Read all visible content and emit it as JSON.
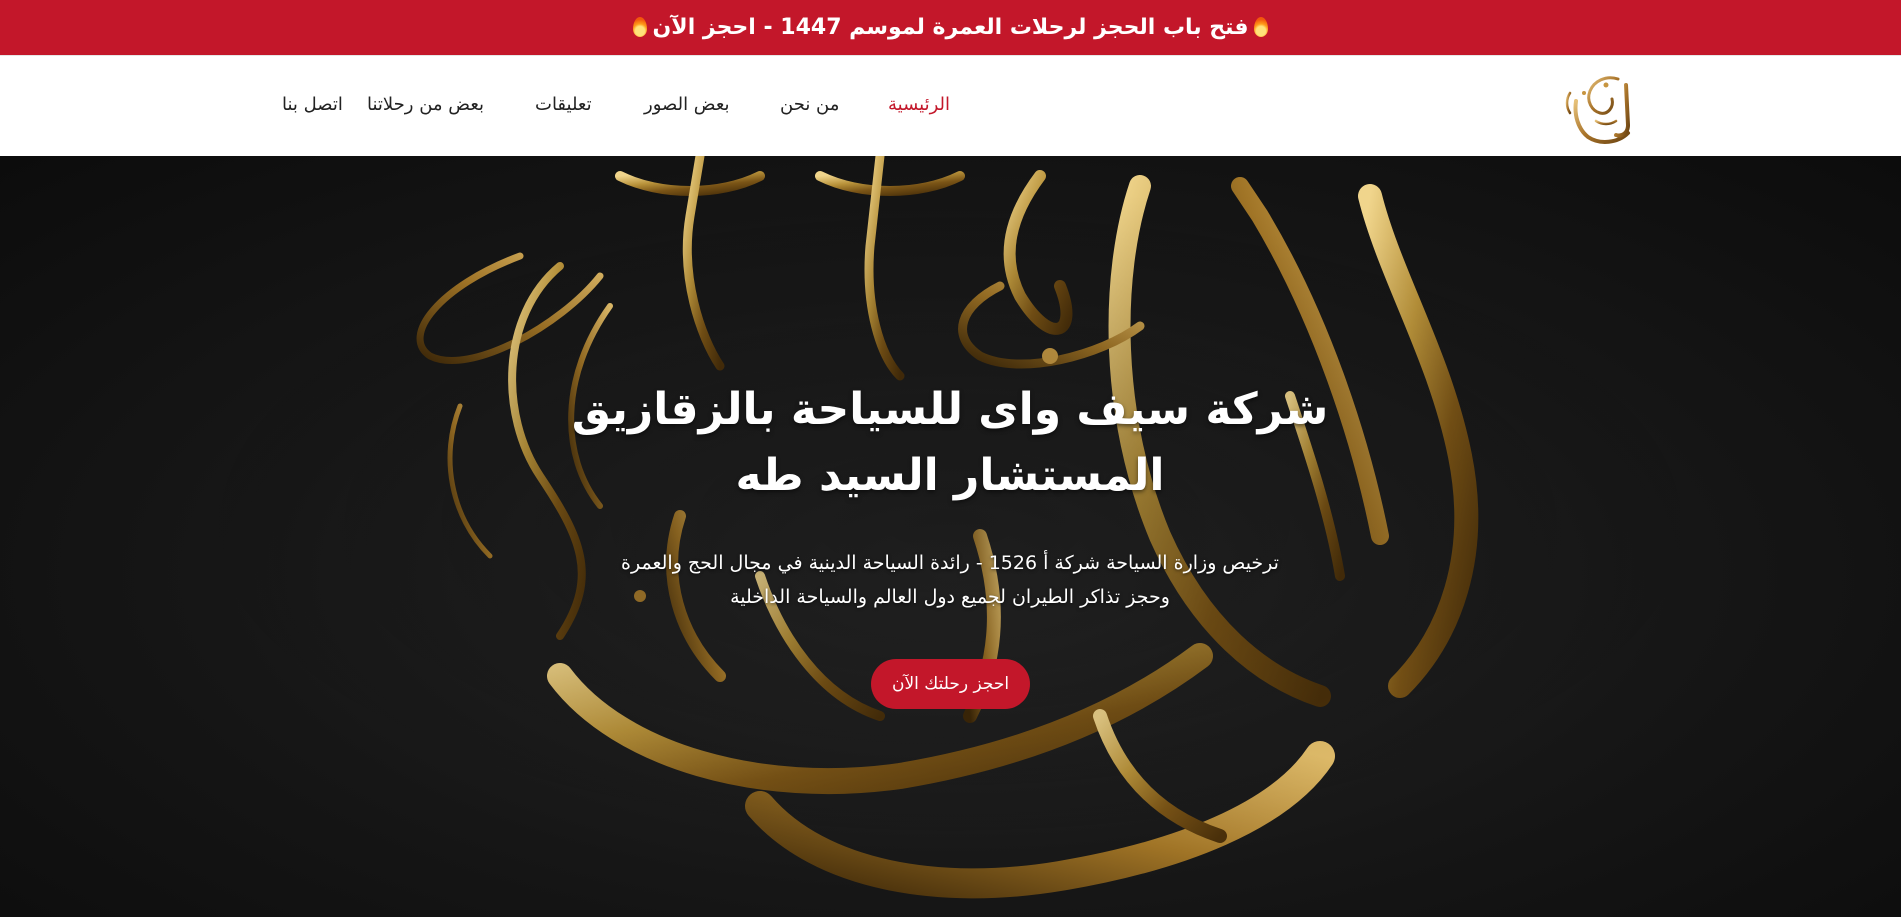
{
  "announcement": {
    "text": "فتح باب الحجز لرحلات العمرة لموسم 1447 - احجز الآن",
    "icon": "fire-icon"
  },
  "nav": {
    "logo_icon": "logo-calligraphy-icon",
    "items": [
      {
        "label": "الرئيسية",
        "active": true
      },
      {
        "label": "من نحن",
        "active": false
      },
      {
        "label": "بعض الصور",
        "active": false
      },
      {
        "label": "تعليقات",
        "active": false
      },
      {
        "label": "بعض من رحلاتنا",
        "active": false
      },
      {
        "label": "اتصل بنا",
        "active": false
      }
    ]
  },
  "hero": {
    "title_line1": "شركة سيف واى للسياحة بالزقازيق",
    "title_line2": "المستشار السيد طه",
    "subtitle_line1": "ترخيص وزارة السياحة شركة أ 1526 - رائدة السياحة الدينية في مجال الحج والعمرة",
    "subtitle_line2": "وحجز تذاكر الطيران لجميع دول العالم والسياحة الداخلية",
    "cta_label": "احجز رحلتك الآن",
    "background_icon": "gold-calligraphy-artwork"
  },
  "colors": {
    "brand_red": "#c3172a",
    "nav_text": "#222222",
    "hero_bg": "#161616",
    "gold": "#b8923a"
  }
}
